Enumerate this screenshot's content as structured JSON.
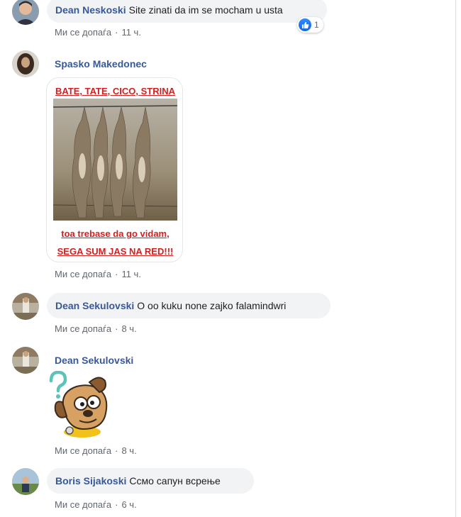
{
  "comments": [
    {
      "author": "Dean Neskoski",
      "text": "Site zinati da im se mocham u usta",
      "like_action": "Ми се допаѓа",
      "time": "11 ч.",
      "reaction_count": "1",
      "avatar_icon": "avatar-photo-icon"
    },
    {
      "author": "Spasko Makedonec",
      "image_text_top": "BATE, TATE, CICO, STRINA",
      "image_text_bottom_1": "toa trebase da go vidam,",
      "image_text_bottom_2": "SEGA SUM JAS NA RED!!!",
      "like_action": "Ми се допаѓа",
      "time": "11 ч.",
      "avatar_icon": "avatar-photo-icon"
    },
    {
      "author": "Dean Sekulovski",
      "text": "O oo kuku none zajko falamindwri",
      "like_action": "Ми се допаѓа",
      "time": "8 ч.",
      "avatar_icon": "avatar-photo-icon"
    },
    {
      "author": "Dean Sekulovski",
      "sticker": "confused-dog-sticker-icon",
      "like_action": "Ми се допаѓа",
      "time": "8 ч.",
      "avatar_icon": "avatar-photo-icon"
    },
    {
      "author": "Boris Sijakoski",
      "text": "Ссмо сапун всрење",
      "like_action": "Ми се допаѓа",
      "time": "6 ч.",
      "avatar_icon": "avatar-photo-icon"
    }
  ],
  "colors": {
    "author_link": "#385898",
    "bubble_bg": "#f2f3f5",
    "meta_text": "#606770",
    "meme_text": "#d21f1f",
    "like_blue": "#1877f2"
  }
}
